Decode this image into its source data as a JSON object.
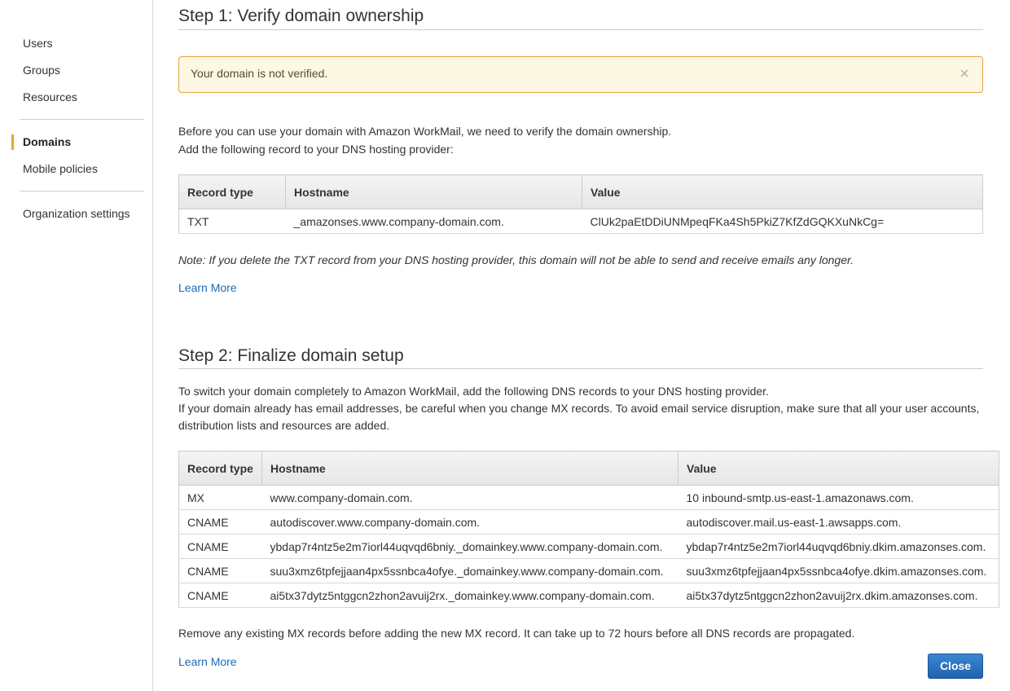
{
  "sidebar": {
    "items": [
      {
        "label": "Users"
      },
      {
        "label": "Groups"
      },
      {
        "label": "Resources"
      },
      {
        "label": "Domains",
        "active": true
      },
      {
        "label": "Mobile policies"
      },
      {
        "label": "Organization settings"
      }
    ],
    "accent_color": "#f0a12b"
  },
  "step1": {
    "title": "Step 1: Verify domain ownership",
    "alert": {
      "text": "Your domain is not verified.",
      "close_icon": "close-icon"
    },
    "intro_line1": "Before you can use your domain with Amazon WorkMail, we need to verify the domain ownership.",
    "intro_line2": "Add the following record to your DNS hosting provider:",
    "table": {
      "headers": [
        "Record type",
        "Hostname",
        "Value"
      ],
      "rows": [
        [
          "TXT",
          "_amazonses.www.company-domain.com.",
          "ClUk2paEtDDiUNMpeqFKa4Sh5PkiZ7KfZdGQKXuNkCg="
        ]
      ]
    },
    "note": "Note: If you delete the TXT record from your DNS hosting provider, this domain will not be able to send and receive emails any longer.",
    "learn_more": "Learn More"
  },
  "step2": {
    "title": "Step 2: Finalize domain setup",
    "intro_line1": "To switch your domain completely to Amazon WorkMail, add the following DNS records to your DNS hosting provider.",
    "intro_line2": "If your domain already has email addresses, be careful when you change MX records. To avoid email service disruption, make sure that all your user accounts,",
    "intro_line3": "distribution lists and resources are added.",
    "table": {
      "headers": [
        "Record type",
        "Hostname",
        "Value"
      ],
      "rows": [
        [
          "MX",
          "www.company-domain.com.",
          "10 inbound-smtp.us-east-1.amazonaws.com."
        ],
        [
          "CNAME",
          "autodiscover.www.company-domain.com.",
          "autodiscover.mail.us-east-1.awsapps.com."
        ],
        [
          "CNAME",
          "ybdap7r4ntz5e2m7iorl44uqvqd6bniy._domainkey.www.company-domain.com.",
          "ybdap7r4ntz5e2m7iorl44uqvqd6bniy.dkim.amazonses.com."
        ],
        [
          "CNAME",
          "suu3xmz6tpfejjaan4px5ssnbca4ofye._domainkey.www.company-domain.com.",
          "suu3xmz6tpfejjaan4px5ssnbca4ofye.dkim.amazonses.com."
        ],
        [
          "CNAME",
          "ai5tx37dytz5ntggcn2zhon2avuij2rx._domainkey.www.company-domain.com.",
          "ai5tx37dytz5ntggcn2zhon2avuij2rx.dkim.amazonses.com."
        ]
      ]
    },
    "footer_text": "Remove any existing MX records before adding the new MX record. It can take up to 72 hours before all DNS records are propagated.",
    "learn_more": "Learn More"
  },
  "footer": {
    "close_label": "Close",
    "close_color": "#1f63b0"
  }
}
